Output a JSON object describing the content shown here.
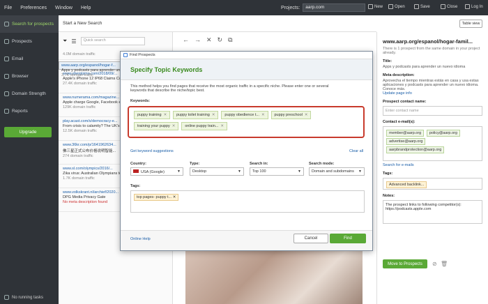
{
  "menu": [
    "File",
    "Preferences",
    "Window",
    "Help"
  ],
  "projects": {
    "label": "Projects:",
    "value": "aarp.com"
  },
  "toolbar": {
    "new": "New",
    "open": "Open",
    "save": "Save",
    "close": "Close",
    "login": "Log In"
  },
  "sidebar": {
    "items": [
      {
        "label": "Search for prospects"
      },
      {
        "label": "Prospects"
      },
      {
        "label": "Email"
      },
      {
        "label": "Browser"
      },
      {
        "label": "Domain Strength"
      },
      {
        "label": "Reports"
      }
    ],
    "upgrade": "Upgrade",
    "bottom": "No running tasks"
  },
  "header": {
    "title": "Start a New Search",
    "table_view": "Table view"
  },
  "list": {
    "search_placeholder": "Quick search",
    "rows": [
      {
        "url": "www.aarp.org/espanol/hogar-f...",
        "title": "Apps y podcasts para aprender un...",
        "meta": "3.7K domain traffic"
      },
      {
        "url": "www.ubergizmo.com/2018/09/...",
        "title": "Apple's iPhone 12 IP68 Claims Co...",
        "meta": "27.4K domain traffic"
      },
      {
        "url": "www.numerama.com/magazine...",
        "title": "Apple charge Google, Facebook et...",
        "meta": "129K domain traffic"
      },
      {
        "url": "play.acast.com/s/democracy-e...",
        "title": "From crisis to calamity? The UK's...",
        "meta": "12.5K domain traffic"
      },
      {
        "url": "www.36kr.com/p/1641962634...",
        "title": "佛三星正式公布价格说明智能...",
        "meta": "274 domain traffic"
      },
      {
        "url": "www.sl.com/olympics/2016/...",
        "title": "Zika virus: Australian Olympians to get condoms to fight Zika",
        "meta": "1.7K domain traffic"
      },
      {
        "url": "www.volkskrant.nl/archief/2020...",
        "title": "DPG Media Privacy Gate",
        "meta": "No meta description found"
      }
    ]
  },
  "dialog": {
    "window_title": "Find Prospects",
    "heading": "Specify Topic Keywords",
    "desc": "This method helps you find pages that receive the most organic traffic in a specific niche. Please enter one or several keywords that describe the niche/topic best.",
    "kw_label": "Keywords:",
    "keywords": [
      "puppy training",
      "puppy toilet training",
      "puppy obedience t...",
      "puppy preschool",
      "training your puppy",
      "online puppy train..."
    ],
    "suggestions": "Get keyword suggestions",
    "clear": "Clear all",
    "country_label": "Country:",
    "country": "USA (Google)",
    "type_label": "Type:",
    "type": "Desktop",
    "search_in_label": "Search in:",
    "search_in": "Top 100",
    "mode_label": "Search mode:",
    "mode": "Domain and subdomains",
    "tags_label": "Tags:",
    "tag": "top pages- puppy t...",
    "help": "Online Help",
    "cancel": "Cancel",
    "find": "Find"
  },
  "right": {
    "url": "www.aarp.org/espanol/hogar-famil...",
    "sub": "There is 1 prospect from the same domain in your project already.",
    "title_h": "Title:",
    "title": "Apps y podcasts para aprender un nuevo idioma",
    "meta_h": "Meta description:",
    "meta": "Aprovecha el tiempo mientras estás en casa y usa estas aplicaciones y podcasts para aprender un nuevo idioma. Conoce más.",
    "update": "Update page info",
    "contact_h": "Prospect contact name:",
    "contact_ph": "Enter contact name",
    "emails_h": "Contact e-mail(s):",
    "emails": [
      "member@aarp.org",
      "policy@aarp.org",
      "advertise@aarp.org",
      "aarpbrandprotection@aarp.org"
    ],
    "search_emails": "Search for e-mails",
    "tags_h": "Tags:",
    "tag": "Advanced backlink...",
    "notes_h": "Notes:",
    "notes": "The prospect links to following competitor(s): https://podcasts.apple.com",
    "move": "Move to Prospects"
  }
}
